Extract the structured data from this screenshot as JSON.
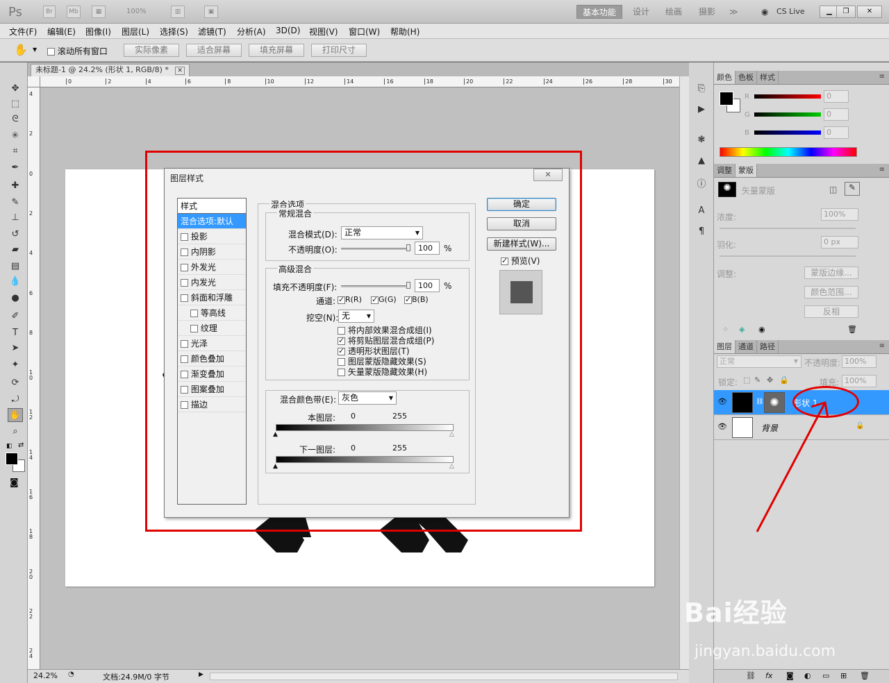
{
  "app": {
    "logo": "Ps",
    "bridge_label": "Br",
    "minibridge_label": "Mb",
    "zoom_value": "100%"
  },
  "workspaces": [
    {
      "label": "基本功能",
      "active": true
    },
    {
      "label": "设计",
      "active": false
    },
    {
      "label": "绘画",
      "active": false
    },
    {
      "label": "摄影",
      "active": false
    },
    {
      "label": "≫",
      "active": false
    }
  ],
  "cs_live": "CS Live",
  "menu": [
    "文件(F)",
    "编辑(E)",
    "图像(I)",
    "图层(L)",
    "选择(S)",
    "滤镜(T)",
    "分析(A)",
    "3D(D)",
    "视图(V)",
    "窗口(W)",
    "帮助(H)"
  ],
  "options_bar": {
    "scroll_all_label": "滚动所有窗口",
    "buttons": [
      "实际像素",
      "适合屏幕",
      "填充屏幕",
      "打印尺寸"
    ]
  },
  "document": {
    "tab_title": "未标题-1 @ 24.2% (形状 1, RGB/8) *",
    "ruler_top_ticks": [
      "0",
      "2",
      "4",
      "6",
      "8",
      "10",
      "12",
      "14",
      "16",
      "18",
      "20",
      "22",
      "24",
      "26",
      "28",
      "30"
    ],
    "ruler_left_ticks": [
      "4",
      "2",
      "0",
      "2",
      "4",
      "6",
      "8",
      "1\n0",
      "1\n2",
      "1\n4",
      "1\n6",
      "1\n8",
      "2\n0",
      "2\n2",
      "2\n4"
    ],
    "zoom": "24.2%",
    "status": "文档:24.9M/0 字节"
  },
  "dialog": {
    "title": "图层样式",
    "styles_header": "样式",
    "styles": [
      {
        "label": "混合选项:默认",
        "selected": true,
        "checkbox": false,
        "indent": false
      },
      {
        "label": "投影",
        "checkbox": true,
        "indent": false
      },
      {
        "label": "内阴影",
        "checkbox": true,
        "indent": false
      },
      {
        "label": "外发光",
        "checkbox": true,
        "indent": false
      },
      {
        "label": "内发光",
        "checkbox": true,
        "indent": false
      },
      {
        "label": "斜面和浮雕",
        "checkbox": true,
        "indent": false
      },
      {
        "label": "等高线",
        "checkbox": true,
        "indent": true
      },
      {
        "label": "纹理",
        "checkbox": true,
        "indent": true
      },
      {
        "label": "光泽",
        "checkbox": true,
        "indent": false
      },
      {
        "label": "颜色叠加",
        "checkbox": true,
        "indent": false
      },
      {
        "label": "渐变叠加",
        "checkbox": true,
        "indent": false
      },
      {
        "label": "图案叠加",
        "checkbox": true,
        "indent": false
      },
      {
        "label": "描边",
        "checkbox": true,
        "indent": false
      }
    ],
    "blend_options_title": "混合选项",
    "general_blend": {
      "title": "常规混合",
      "mode_label": "混合模式(D):",
      "mode_value": "正常",
      "opacity_label": "不透明度(O):",
      "opacity_value": "100",
      "percent": "%"
    },
    "advanced_blend": {
      "title": "高级混合",
      "fill_label": "填充不透明度(F):",
      "fill_value": "100",
      "percent": "%",
      "channels_label": "通道:",
      "channels": [
        "R(R)",
        "G(G)",
        "B(B)"
      ],
      "knockout_label": "挖空(N):",
      "knockout_value": "无",
      "options": [
        {
          "label": "将内部效果混合成组(I)",
          "checked": false
        },
        {
          "label": "将剪贴图层混合成组(P)",
          "checked": true
        },
        {
          "label": "透明形状图层(T)",
          "checked": true
        },
        {
          "label": "图层蒙版隐藏效果(S)",
          "checked": false
        },
        {
          "label": "矢量蒙版隐藏效果(H)",
          "checked": false
        }
      ]
    },
    "blend_if": {
      "label": "混合颜色带(E):",
      "value": "灰色",
      "this_layer": "本图层:",
      "underlying": "下一图层:",
      "min": "0",
      "max": "255"
    },
    "buttons": {
      "ok": "确定",
      "cancel": "取消",
      "new_style": "新建样式(W)...",
      "preview": "预览(V)"
    }
  },
  "color_panel": {
    "tabs": [
      "颜色",
      "色板",
      "样式"
    ],
    "channels": [
      {
        "label": "R",
        "value": "0"
      },
      {
        "label": "G",
        "value": "0"
      },
      {
        "label": "B",
        "value": "0"
      }
    ]
  },
  "masks_panel": {
    "tabs": [
      "调整",
      "蒙版"
    ],
    "title": "矢量蒙版",
    "density_label": "浓度:",
    "density_value": "100%",
    "feather_label": "羽化:",
    "feather_value": "0 px",
    "refine_label": "调整:",
    "buttons": [
      "蒙版边缘...",
      "颜色范围...",
      "反相"
    ]
  },
  "layers_panel": {
    "tabs": [
      "图层",
      "通道",
      "路径"
    ],
    "blend_mode": "正常",
    "opacity_label": "不透明度:",
    "opacity_value": "100%",
    "lock_label": "锁定:",
    "fill_label": "填充:",
    "fill_value": "100%",
    "layers": [
      {
        "name": "形状 1",
        "selected": true
      },
      {
        "name": "背景",
        "selected": false
      }
    ]
  },
  "watermark": {
    "main": "Bai经验",
    "sub": "jingyan.baidu.com"
  }
}
